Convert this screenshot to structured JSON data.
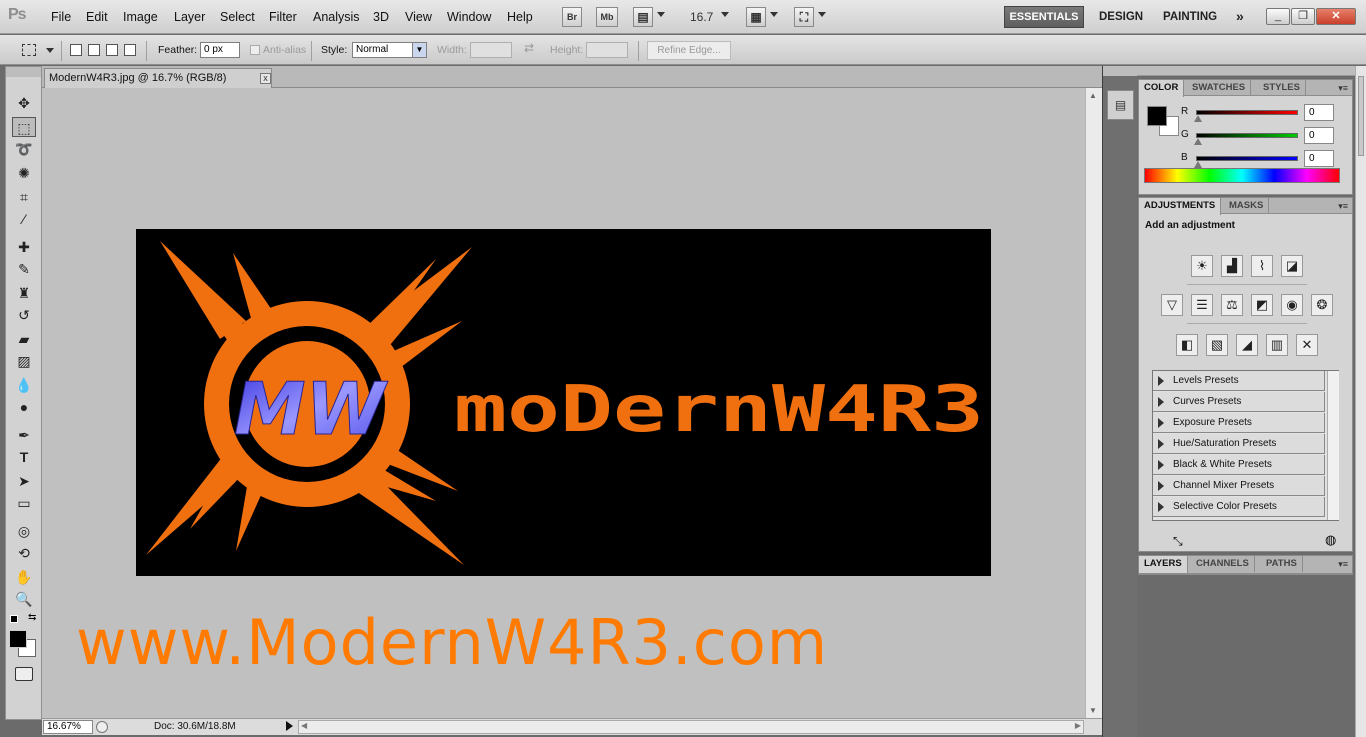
{
  "menubar": {
    "app_icon": "Ps",
    "menus": [
      "File",
      "Edit",
      "Image",
      "Layer",
      "Select",
      "Filter",
      "Analysis",
      "3D",
      "View",
      "Window",
      "Help"
    ],
    "bridge": "Br",
    "minibridge": "Mb",
    "zoom": "16.7",
    "workspaces": {
      "active": "ESSENTIALS",
      "design": "DESIGN",
      "painting": "PAINTING",
      "more": "»"
    },
    "window_buttons": {
      "minimize": "_",
      "restore": "❐",
      "close": "✕"
    }
  },
  "options": {
    "feather_label": "Feather:",
    "feather_value": "0 px",
    "antialias_label": "Anti-alias",
    "style_label": "Style:",
    "style_value": "Normal",
    "width_label": "Width:",
    "height_label": "Height:",
    "refine_label": "Refine Edge..."
  },
  "document": {
    "tab_title": "ModernW4R3.jpg @ 16.7% (RGB/8)",
    "close_glyph": "x",
    "logo_initials": "MW",
    "logo_text": "moDernW4R3",
    "watermark": "www.ModernW4R3.com"
  },
  "status": {
    "zoom": "16.67%",
    "doc_info": "Doc: 30.6M/18.8M"
  },
  "color_panel": {
    "tabs": [
      "COLOR",
      "SWATCHES",
      "STYLES"
    ],
    "channels": [
      {
        "name": "R",
        "value": "0",
        "color": "#ff0000"
      },
      {
        "name": "G",
        "value": "0",
        "color": "#00cc00"
      },
      {
        "name": "B",
        "value": "0",
        "color": "#0000ff"
      }
    ],
    "foreground": "#000000",
    "background": "#ffffff"
  },
  "adjustments_panel": {
    "tabs": [
      "ADJUSTMENTS",
      "MASKS"
    ],
    "heading": "Add an adjustment",
    "presets": [
      "Levels Presets",
      "Curves Presets",
      "Exposure Presets",
      "Hue/Saturation Presets",
      "Black & White Presets",
      "Channel Mixer Presets",
      "Selective Color Presets"
    ]
  },
  "layers_panel": {
    "tabs": [
      "LAYERS",
      "CHANNELS",
      "PATHS"
    ]
  },
  "colors": {
    "accent_orange": "#ff7a00",
    "logo_orange": "#f07010",
    "mw_blue": "#6f6cf0"
  }
}
